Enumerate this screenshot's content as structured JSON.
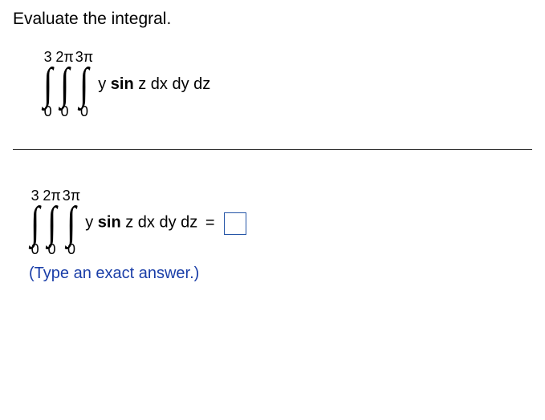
{
  "prompt": "Evaluate the integral.",
  "integral1": {
    "limits_top": [
      "3",
      "2π",
      "3π"
    ],
    "limits_bottom": [
      "0",
      "0",
      "0"
    ],
    "integrand_y": "y ",
    "integrand_sin": "sin",
    "integrand_rest": " z dx dy dz"
  },
  "integral2": {
    "limits_top": [
      "3",
      "2π",
      "3π"
    ],
    "limits_bottom": [
      "0",
      "0",
      "0"
    ],
    "integrand_y": "y ",
    "integrand_sin": "sin",
    "integrand_rest": " z dx dy dz",
    "equals": " = "
  },
  "hint": "(Type an exact answer.)"
}
